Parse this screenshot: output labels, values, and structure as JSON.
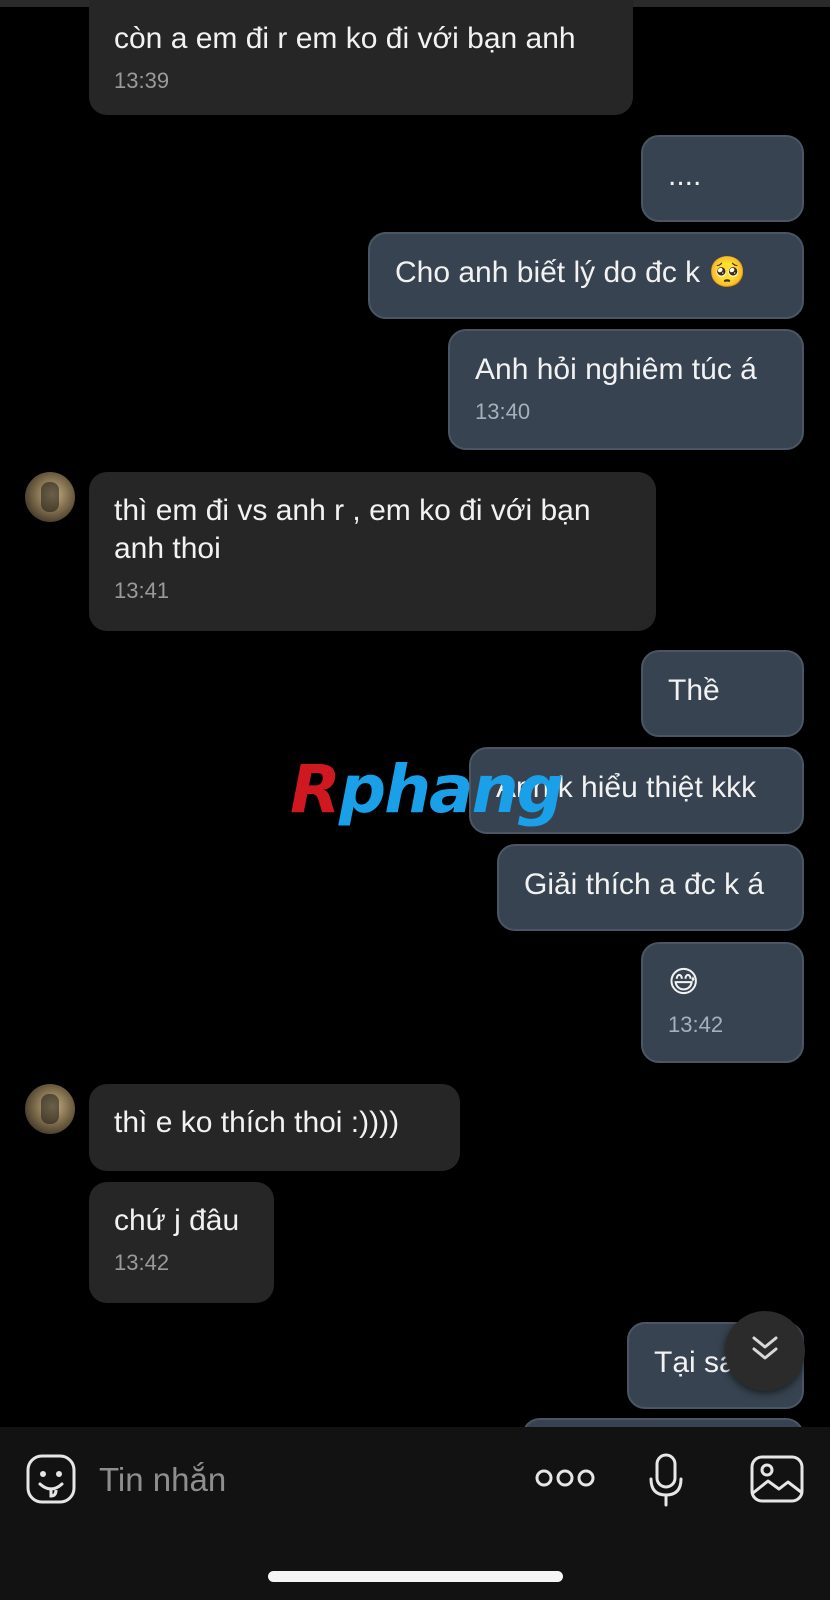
{
  "messages": [
    {
      "side": "in",
      "text": "còn a em đi r em ko đi với bạn anh",
      "time": "13:39"
    },
    {
      "side": "out",
      "text": "...."
    },
    {
      "side": "out",
      "text": "Cho anh biết lý do đc k 🥺"
    },
    {
      "side": "out",
      "text": "Anh hỏi nghiêm túc á",
      "time": "13:40"
    },
    {
      "side": "in",
      "text": "thì em đi vs anh r , em ko đi với bạn anh thoi",
      "time": "13:41"
    },
    {
      "side": "out",
      "text": "Thề"
    },
    {
      "side": "out",
      "text": "Anh k hiểu thiệt kkk"
    },
    {
      "side": "out",
      "text": "Giải thích a đc k á"
    },
    {
      "side": "out",
      "text": "😅",
      "time": "13:42"
    },
    {
      "side": "in",
      "text": "thì e ko thích thoi :))))"
    },
    {
      "side": "in",
      "text": "chứ j đâu",
      "time": "13:42"
    },
    {
      "side": "out",
      "text": "Tại sa"
    }
  ],
  "watermark": {
    "first": "R",
    "rest": "phang"
  },
  "composer": {
    "placeholder": "Tin nhắn",
    "icons": [
      "sticker-icon",
      "more-icon",
      "microphone-icon",
      "gallery-icon"
    ]
  },
  "scroll_button": {
    "icon": "chevron-double-down-icon"
  },
  "colors": {
    "background": "#000000",
    "incoming": "#262626",
    "outgoing": "#374350",
    "composer": "#121212"
  }
}
